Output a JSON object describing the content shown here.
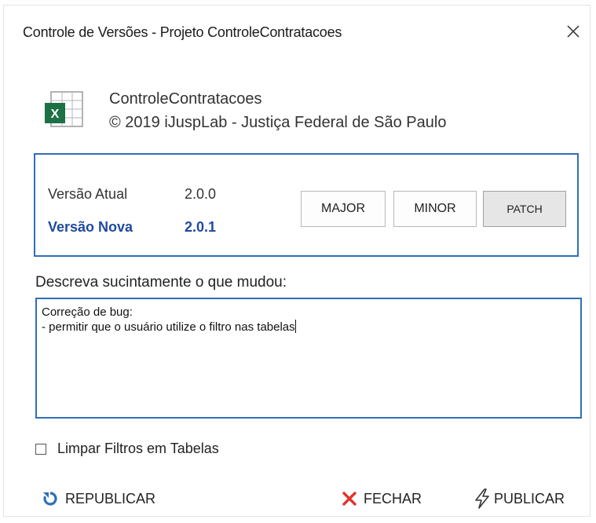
{
  "window": {
    "title": "Controle de Versões - Projeto ControleContratacoes",
    "close_glyph": "✕"
  },
  "project": {
    "name": "ControleContratacoes",
    "copyright": "© 2019 iJuspLab - Justiça Federal de São Paulo",
    "icon": "excel-file-icon"
  },
  "versions": {
    "current_label": "Versão Atual",
    "current_value": "2.0.0",
    "new_label": "Versão Nova",
    "new_value": "2.0.1",
    "buttons": {
      "major": "MAJOR",
      "minor": "MINOR",
      "patch": "PATCH"
    },
    "selected": "PATCH"
  },
  "description": {
    "label": "Descreva sucintamente o que mudou:",
    "text": "Correção de bug:\n- permitir que o usuário utilize o filtro nas tabelas"
  },
  "clear_filters": {
    "label": "Limpar Filtros em Tabelas",
    "checked": false
  },
  "footer": {
    "republish_label": "REPUBLICAR",
    "close_label": "FECHAR",
    "publish_label": "PUBLICAR",
    "republish_icon": "refresh-icon",
    "close_icon": "close-icon",
    "publish_icon": "lightning-icon"
  },
  "colors": {
    "accent_border": "#2f6fb7",
    "new_version_text": "#1f4aa0",
    "republish_icon": "#2f6fb7",
    "close_icon": "#e0332b",
    "excel_green": "#1e7145"
  }
}
